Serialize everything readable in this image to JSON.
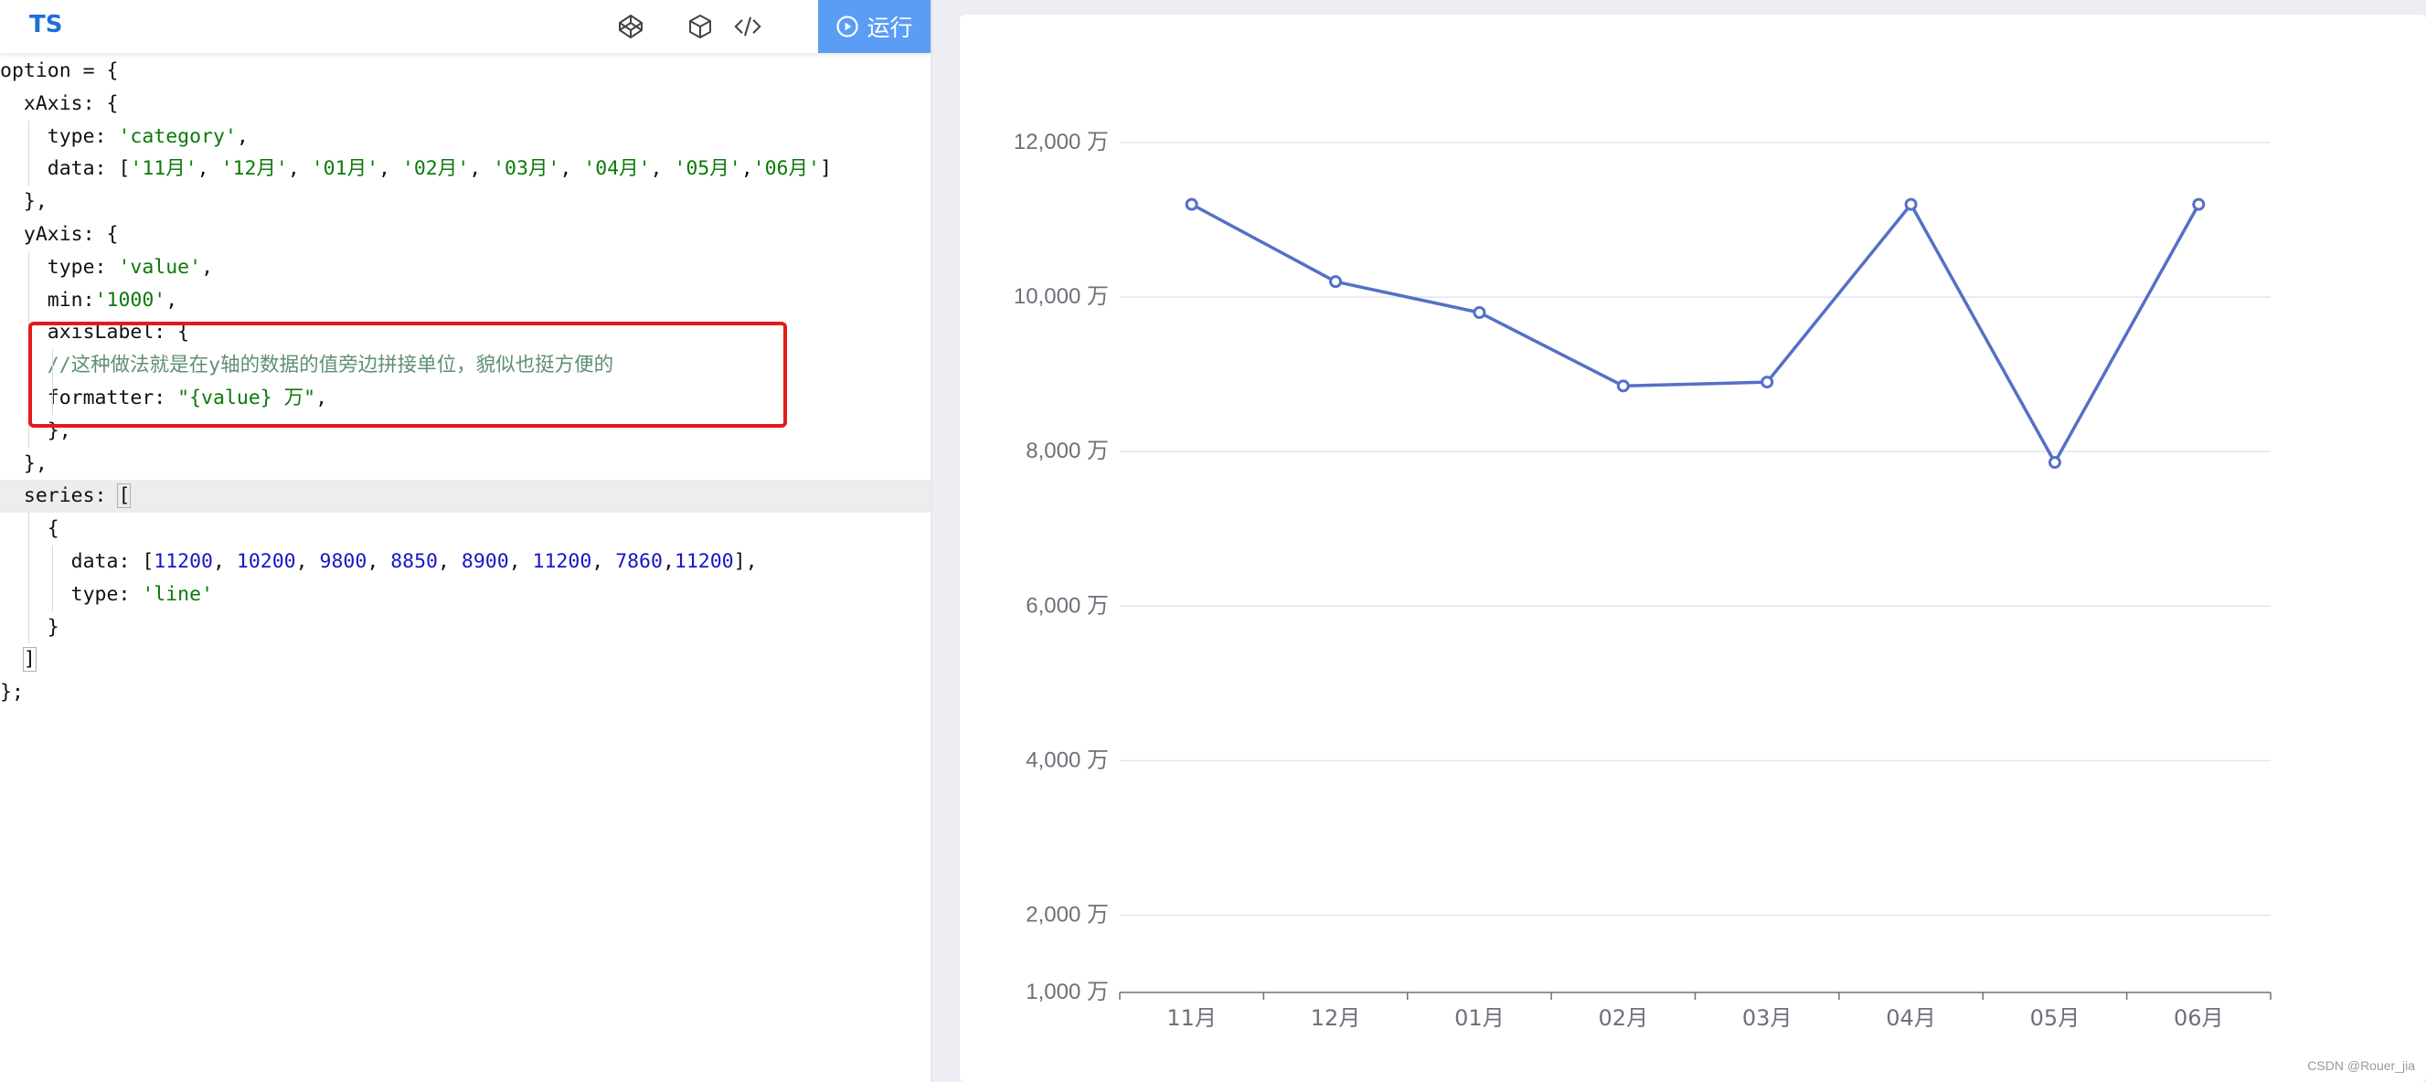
{
  "toolbar": {
    "lang_label": "TS",
    "icons": [
      "codepen-icon",
      "cube-icon",
      "code-icon"
    ],
    "run_label": "运行",
    "run_icon": "play-circle-icon",
    "accent_color": "#5b9cf5"
  },
  "code": {
    "lines": [
      [
        {
          "t": "option = {",
          "c": ""
        }
      ],
      [
        {
          "t": "  xAxis: {",
          "c": ""
        }
      ],
      [
        {
          "t": "    type: ",
          "c": ""
        },
        {
          "t": "'category'",
          "c": "str"
        },
        {
          "t": ",",
          "c": ""
        }
      ],
      [
        {
          "t": "    data: [",
          "c": ""
        },
        {
          "t": "'11月'",
          "c": "str"
        },
        {
          "t": ", ",
          "c": ""
        },
        {
          "t": "'12月'",
          "c": "str"
        },
        {
          "t": ", ",
          "c": ""
        },
        {
          "t": "'01月'",
          "c": "str"
        },
        {
          "t": ", ",
          "c": ""
        },
        {
          "t": "'02月'",
          "c": "str"
        },
        {
          "t": ", ",
          "c": ""
        },
        {
          "t": "'03月'",
          "c": "str"
        },
        {
          "t": ", ",
          "c": ""
        },
        {
          "t": "'04月'",
          "c": "str"
        },
        {
          "t": ", ",
          "c": ""
        },
        {
          "t": "'05月'",
          "c": "str"
        },
        {
          "t": ",",
          "c": ""
        },
        {
          "t": "'06月'",
          "c": "str"
        },
        {
          "t": "]",
          "c": ""
        }
      ],
      [
        {
          "t": "  },",
          "c": ""
        }
      ],
      [
        {
          "t": "  yAxis: {",
          "c": ""
        }
      ],
      [
        {
          "t": "    type: ",
          "c": ""
        },
        {
          "t": "'value'",
          "c": "str"
        },
        {
          "t": ",",
          "c": ""
        }
      ],
      [
        {
          "t": "    min:",
          "c": ""
        },
        {
          "t": "'1000'",
          "c": "str"
        },
        {
          "t": ",",
          "c": ""
        }
      ],
      [
        {
          "t": "    axisLabel: {",
          "c": ""
        }
      ],
      [
        {
          "t": "    //这种做法就是在y轴的数据的值旁边拼接单位，貌似也挺方便的",
          "c": "com"
        }
      ],
      [
        {
          "t": "    formatter: ",
          "c": ""
        },
        {
          "t": "\"{value} 万\"",
          "c": "str"
        },
        {
          "t": ",",
          "c": ""
        }
      ],
      [
        {
          "t": "    },",
          "c": ""
        }
      ],
      [
        {
          "t": "  },",
          "c": ""
        }
      ],
      [
        {
          "t": "  series: ",
          "c": ""
        },
        {
          "t": "[",
          "c": "box"
        }
      ],
      [
        {
          "t": "    {",
          "c": ""
        }
      ],
      [
        {
          "t": "      data: [",
          "c": ""
        },
        {
          "t": "11200",
          "c": "num"
        },
        {
          "t": ", ",
          "c": ""
        },
        {
          "t": "10200",
          "c": "num"
        },
        {
          "t": ", ",
          "c": ""
        },
        {
          "t": "9800",
          "c": "num"
        },
        {
          "t": ", ",
          "c": ""
        },
        {
          "t": "8850",
          "c": "num"
        },
        {
          "t": ", ",
          "c": ""
        },
        {
          "t": "8900",
          "c": "num"
        },
        {
          "t": ", ",
          "c": ""
        },
        {
          "t": "11200",
          "c": "num"
        },
        {
          "t": ", ",
          "c": ""
        },
        {
          "t": "7860",
          "c": "num"
        },
        {
          "t": ",",
          "c": ""
        },
        {
          "t": "11200",
          "c": "num"
        },
        {
          "t": "],",
          "c": ""
        }
      ],
      [
        {
          "t": "      type: ",
          "c": ""
        },
        {
          "t": "'line'",
          "c": "str"
        }
      ],
      [
        {
          "t": "    }",
          "c": ""
        }
      ],
      [
        {
          "t": "  ",
          "c": ""
        },
        {
          "t": "]",
          "c": "box"
        }
      ],
      [
        {
          "t": "};",
          "c": ""
        }
      ]
    ],
    "active_line": 13
  },
  "chart_data": {
    "type": "line",
    "categories": [
      "11月",
      "12月",
      "01月",
      "02月",
      "03月",
      "04月",
      "05月",
      "06月"
    ],
    "series": [
      {
        "values": [
          11200,
          10200,
          9800,
          8850,
          8900,
          11200,
          7860,
          11200
        ]
      }
    ],
    "yticks": [
      1000,
      2000,
      4000,
      6000,
      8000,
      10000,
      12000
    ],
    "ytick_labels": [
      "1,000 万",
      "2,000 万",
      "4,000 万",
      "6,000 万",
      "8,000 万",
      "10,000 万",
      "12,000 万"
    ],
    "ylim": [
      1000,
      12000
    ],
    "line_color": "#5470c6",
    "grid": true,
    "title": "",
    "xlabel": "",
    "ylabel": ""
  },
  "watermark": "CSDN @Rouer_jia"
}
